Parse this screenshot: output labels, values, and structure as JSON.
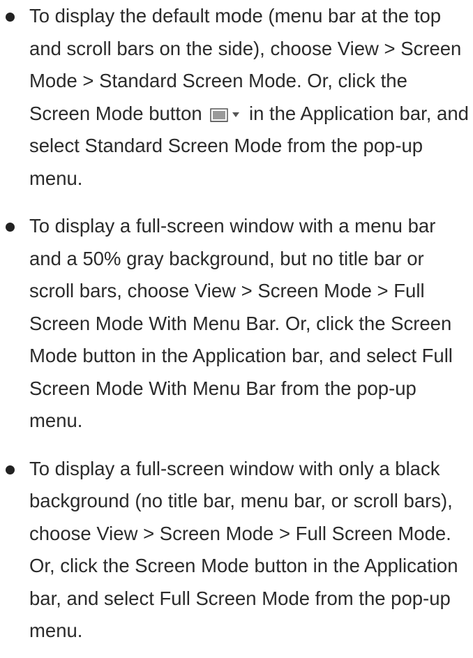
{
  "bullets": [
    {
      "before_icon": "To display the default mode (menu bar at the top and scroll bars on the side), choose View > Screen Mode > Standard Screen Mode. Or, click the Screen Mode button",
      "icon": "screen-mode-icon",
      "after_icon": "in the Application bar, and select Standard Screen Mode from the pop-up menu."
    },
    {
      "text": "To display a full-screen window with a menu bar and a 50% gray background, but no title bar or scroll bars, choose View > Screen Mode > Full Screen Mode With Menu Bar. Or, click the Screen Mode button in the Application bar, and select Full Screen Mode With Menu Bar from the pop-up menu."
    },
    {
      "text": "To display a full-screen window with only a black background (no title bar, menu bar, or scroll bars), choose View > Screen Mode > Full Screen Mode. Or, click the Screen Mode button in the Application bar, and select Full Screen Mode from the pop-up menu."
    }
  ],
  "colors": {
    "text": "#2b2b2b",
    "bullet": "#222222",
    "icon_frame": "#555555",
    "icon_fill": "#9a9a9a"
  }
}
